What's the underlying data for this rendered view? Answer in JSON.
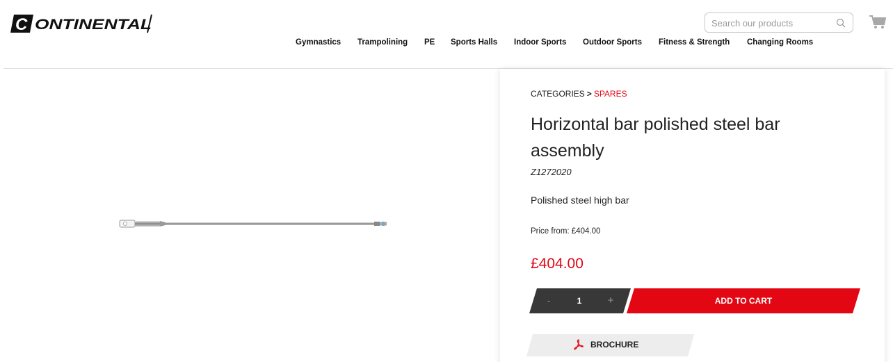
{
  "header": {
    "logo_text": "CONTINENTAL",
    "search": {
      "placeholder": "Search our products",
      "value": ""
    },
    "icons": {
      "search": "search-icon",
      "cart": "cart-icon"
    }
  },
  "nav": {
    "items": [
      {
        "label": "Gymnastics"
      },
      {
        "label": "Trampolining"
      },
      {
        "label": "PE"
      },
      {
        "label": "Sports Halls"
      },
      {
        "label": "Indoor Sports"
      },
      {
        "label": "Outdoor Sports"
      },
      {
        "label": "Fitness & Strength"
      },
      {
        "label": "Changing Rooms"
      }
    ]
  },
  "breadcrumb": {
    "root": "CATEGORIES",
    "separator": ">",
    "current": "SPARES"
  },
  "product": {
    "title": "Horizontal bar polished steel bar assembly",
    "sku": "Z1272020",
    "description": "Polished steel high bar",
    "price_from": "Price from: £404.00",
    "price": "£404.00",
    "quantity": "1",
    "minus_label": "-",
    "plus_label": "+",
    "add_to_cart_label": "ADD TO CART",
    "brochure_label": "BROCHURE",
    "brochure_icon": "pdf-icon"
  },
  "colors": {
    "accent": "#e30613",
    "dark": "#383838",
    "brochure_bg": "#ededed"
  }
}
